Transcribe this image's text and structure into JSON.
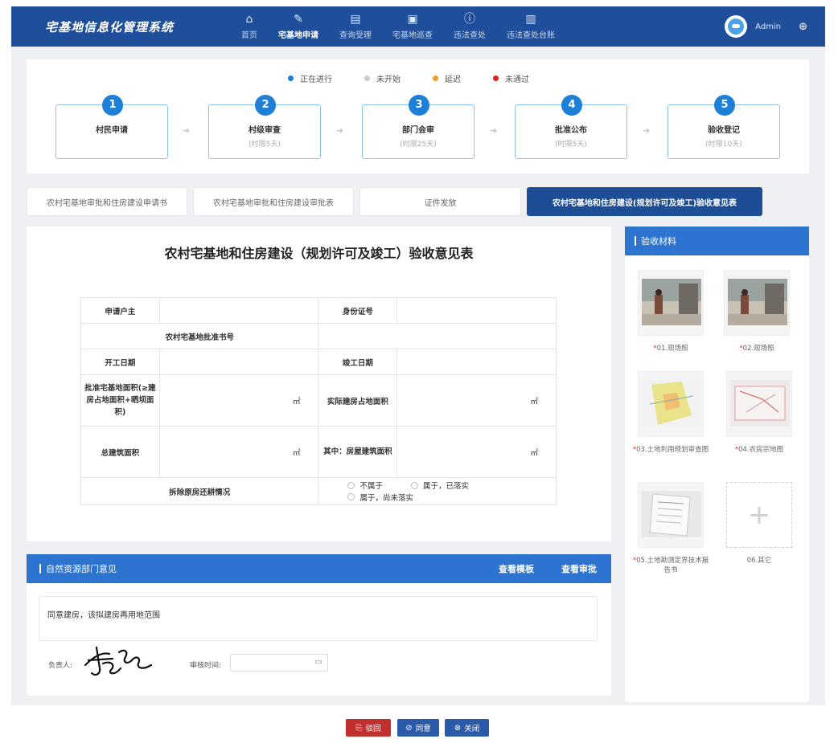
{
  "app": {
    "title": "宅基地信息化管理系统"
  },
  "nav": {
    "items": [
      {
        "label": "首页",
        "icon": "home-icon"
      },
      {
        "label": "宅基地申请",
        "icon": "edit-icon"
      },
      {
        "label": "查询受理",
        "icon": "search-doc-icon"
      },
      {
        "label": "宅基地巡查",
        "icon": "file-icon"
      },
      {
        "label": "违法查处",
        "icon": "alert-icon"
      },
      {
        "label": "违法查处台账",
        "icon": "ledger-icon"
      }
    ],
    "active": "宅基地申请",
    "user": "Admin"
  },
  "legend": [
    {
      "label": "正在进行",
      "color": "#1d7fd6"
    },
    {
      "label": "未开始",
      "color": "#cccccc"
    },
    {
      "label": "延迟",
      "color": "#f29b2e"
    },
    {
      "label": "未通过",
      "color": "#e02020"
    }
  ],
  "steps": [
    {
      "num": "1",
      "name": "村民申请",
      "limit": ""
    },
    {
      "num": "2",
      "name": "村级审查",
      "limit": "(时限5天)"
    },
    {
      "num": "3",
      "name": "部门会审",
      "limit": "(时限25天)"
    },
    {
      "num": "4",
      "name": "批准公布",
      "limit": "(时限5天)"
    },
    {
      "num": "5",
      "name": "验收登记",
      "limit": "(时限10天)"
    }
  ],
  "doc_tabs": [
    "农村宅基地审批和住房建设申请书",
    "农村宅基地审批和住房建设审批表",
    "证件发放",
    "农村宅基地和住房建设(规划许可及竣工)验收意见表"
  ],
  "form": {
    "title": "农村宅基地和住房建设（规划许可及竣工）验收意见表",
    "labels": {
      "applicant": "申请户主",
      "id_no": "身份证号",
      "approval_no": "农村宅基地批准书号",
      "start_date": "开工日期",
      "end_date": "竣工日期",
      "approved_area": "批准宅基地面积(≥建房占地面积+晒坝面积)",
      "actual_area": "实际建房占地面积",
      "total_area": "总建筑面积",
      "house_area": "其中：房屋建筑面积",
      "demolish": "拆除原房还耕情况"
    },
    "unit": "㎡",
    "demolish_options": [
      "不属于",
      "属于，已落实",
      "属于，尚未落实"
    ]
  },
  "opinion": {
    "header": "自然资源部门意见",
    "view_template": "查看模板",
    "view_approval": "查看审批",
    "text": "同意建房，该拟建房再用地范围",
    "signer_label": "负责人:",
    "date_label": "审核时间:"
  },
  "materials": {
    "header": "验收材料",
    "items": [
      {
        "label": "01.现场照",
        "required": true
      },
      {
        "label": "02.现场照",
        "required": true
      },
      {
        "label": "03.土地利用规划审查图",
        "required": true
      },
      {
        "label": "04.农房宗地图",
        "required": true
      },
      {
        "label": "05.土地勘测定界技术报告书",
        "required": true
      },
      {
        "label": "06.其它",
        "required": false
      }
    ]
  },
  "buttons": {
    "reject": "驳回",
    "approve": "同意",
    "close": "关闭"
  },
  "colors": {
    "nav_bg": "#1f4f9a",
    "accent": "#2d74d0",
    "reject": "#c0302f",
    "approve": "#2a5aa8"
  }
}
